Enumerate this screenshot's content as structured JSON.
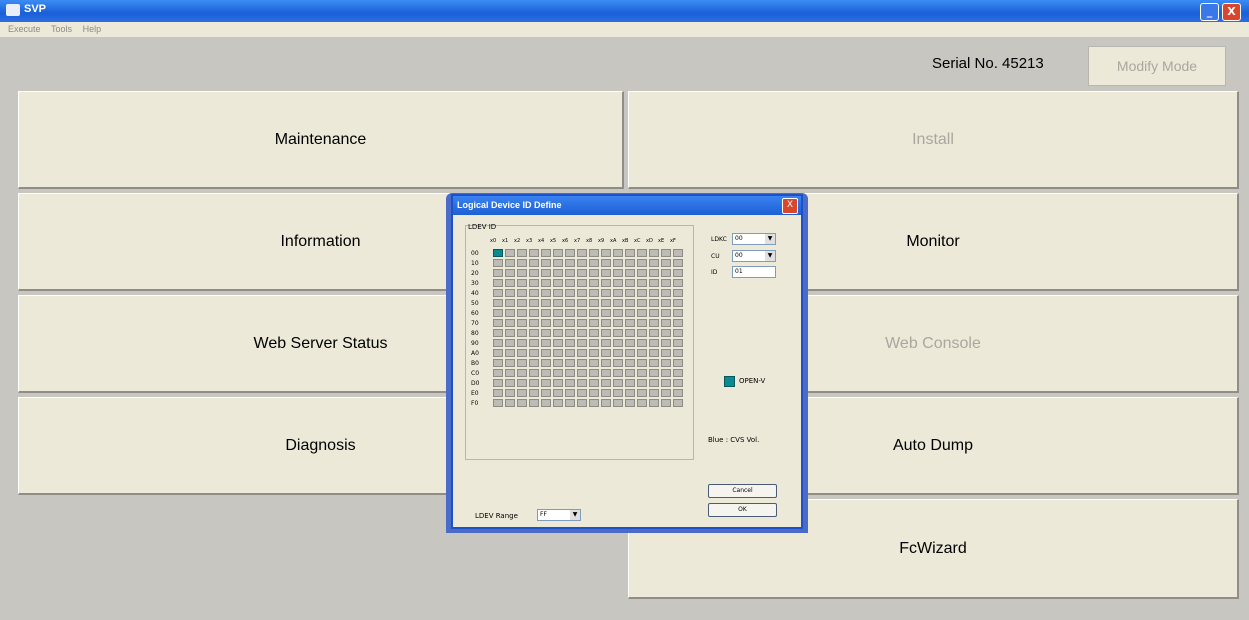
{
  "window": {
    "title": "SVP",
    "minimize_glyph": "_",
    "close_glyph": "X"
  },
  "menu": [
    "Execute",
    "Tools",
    "Help"
  ],
  "header": {
    "serial": "Serial No. 45213",
    "modify_mode_label": "Modify Mode"
  },
  "buttons": {
    "maintenance": "Maintenance",
    "install": "Install",
    "information": "Information",
    "monitor": "Monitor",
    "web_server_status": "Web Server Status",
    "web_console": "Web Console",
    "diagnosis": "Diagnosis",
    "auto_dump": "Auto Dump",
    "fcwizard": "FcWizard"
  },
  "dialog": {
    "title": "Logical Device ID Define",
    "close_glyph": "X",
    "ldev_id_label": "LDEV ID",
    "columns": [
      "x0",
      "x1",
      "x2",
      "x3",
      "x4",
      "x5",
      "x6",
      "x7",
      "x8",
      "x9",
      "xA",
      "xB",
      "xC",
      "xD",
      "xE",
      "xF"
    ],
    "rows": [
      "00",
      "10",
      "20",
      "30",
      "40",
      "50",
      "60",
      "70",
      "80",
      "90",
      "A0",
      "B0",
      "C0",
      "D0",
      "E0",
      "F0"
    ],
    "selected_cell": {
      "row": "00",
      "col": "x0"
    },
    "ldkc_label": "LDKC",
    "ldkc_value": "00",
    "cu_label": "CU",
    "cu_value": "00",
    "id_label": "ID",
    "id_value": "01",
    "open_v_label": "OPEN-V",
    "blue_note": "Blue : CVS Vol.",
    "ldev_range_label": "LDEV Range",
    "ldev_range_value": "FF",
    "cancel_label": "Cancel",
    "ok_label": "OK"
  },
  "colors": {
    "accent": "#1d5fd5",
    "selected_cell": "#0b8a8f",
    "background": "#c8c6c0",
    "button_face": "#ece9d8"
  }
}
